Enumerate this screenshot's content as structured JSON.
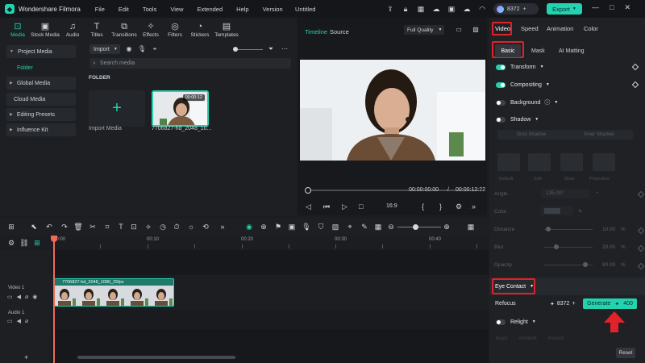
{
  "app": {
    "name": "Wondershare Filmora",
    "title": "Untitled"
  },
  "menu": [
    "File",
    "Edit",
    "Tools",
    "View",
    "Extended",
    "Help",
    "Version"
  ],
  "credits": "8372",
  "export_label": "Export",
  "media_tabs": [
    {
      "label": "Media",
      "icon": "media-icon"
    },
    {
      "label": "Stock Media",
      "icon": "stock-media-icon"
    },
    {
      "label": "Audio",
      "icon": "music-note-icon"
    },
    {
      "label": "Titles",
      "icon": "titles-icon"
    },
    {
      "label": "Transitions",
      "icon": "transitions-icon"
    },
    {
      "label": "Effects",
      "icon": "effects-icon"
    },
    {
      "label": "Filters",
      "icon": "filters-icon"
    },
    {
      "label": "Stickers",
      "icon": "stickers-icon"
    },
    {
      "label": "Templates",
      "icon": "templates-icon"
    }
  ],
  "sidebar": {
    "project_media": "Project Media",
    "folder": "Folder",
    "global_media": "Global Media",
    "cloud_media": "Cloud Media",
    "editing_presets": "Editing Presets",
    "influence_kit": "Influence Kit"
  },
  "media": {
    "import_label": "Import",
    "search_placeholder": "Search media",
    "folder_heading": "FOLDER",
    "import_media": "Import Media",
    "clip_name": "7706827-hd_2048_10...",
    "clip_duration": "00:00:12"
  },
  "player": {
    "tab_timeline": "Timeline",
    "tab_source": "Source",
    "quality": "Full Quality",
    "current_time": "00:00:00:00",
    "separator": "/",
    "total_time": "00:00:12:22",
    "aspect": "16:9"
  },
  "props": {
    "tabs": [
      "Video",
      "Speed",
      "Animation",
      "Color"
    ],
    "subtabs": [
      "Basic",
      "Mask",
      "AI Matting"
    ],
    "transform": "Transform",
    "compositing": "Compositing",
    "background": "Background",
    "shadow": "Shadow",
    "drop_shadow": "Drop Shadow",
    "inner_shadow": "Inner Shadow",
    "shadow_types": [
      "Default",
      "Soft",
      "Glow",
      "Projection"
    ],
    "angle_label": "Angle",
    "angle_value": "135.00°",
    "color_label": "Color",
    "distance_label": "Distance",
    "distance_value": "10.00",
    "blur_label": "Blur",
    "blur_value": "20.00",
    "opacity_label": "Opacity",
    "opacity_value": "80.00",
    "percent": "%",
    "eye_contact": "Eye Contact",
    "refocus": "Refocus",
    "refocus_credits": "8372",
    "generate_label": "Generate",
    "generate_cost": "400",
    "relight": "Relight",
    "relight_tabs": [
      "Basic",
      "Ambient",
      "Presets"
    ],
    "reset": "Reset",
    "accent": "#23d3b0",
    "highlight": "#e0232a"
  },
  "timeline": {
    "ruler": [
      "00:00",
      "00:10",
      "00:20",
      "00:30",
      "00:40"
    ],
    "video_track": "Video 1",
    "audio_track": "Audio 1",
    "clip_label": "7706827-hd_2048_1080_25fps"
  }
}
